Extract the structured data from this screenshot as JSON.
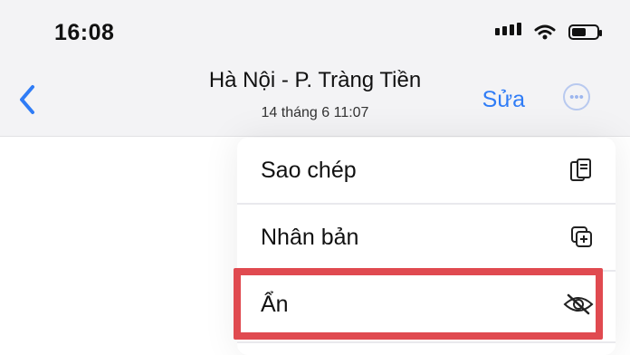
{
  "status_bar": {
    "time": "16:08",
    "icons": [
      "signal-icon",
      "wifi-icon",
      "battery-icon"
    ]
  },
  "nav": {
    "back_icon": "chevron-left-icon",
    "title": "Hà Nội - P. Tràng Tiền",
    "subtitle": "14 tháng 6  11:07",
    "edit_label": "Sửa",
    "more_icon": "ellipsis-circle-icon"
  },
  "menu": {
    "items": [
      {
        "label": "Sao chép",
        "icon": "copy-icon"
      },
      {
        "label": "Nhân bản",
        "icon": "duplicate-icon"
      },
      {
        "label": "Ẩn",
        "icon": "eye-slash-icon"
      }
    ]
  },
  "colors": {
    "accent": "#2f7cf6",
    "highlight": "#e04a50",
    "topbar": "#f3f3f5"
  }
}
